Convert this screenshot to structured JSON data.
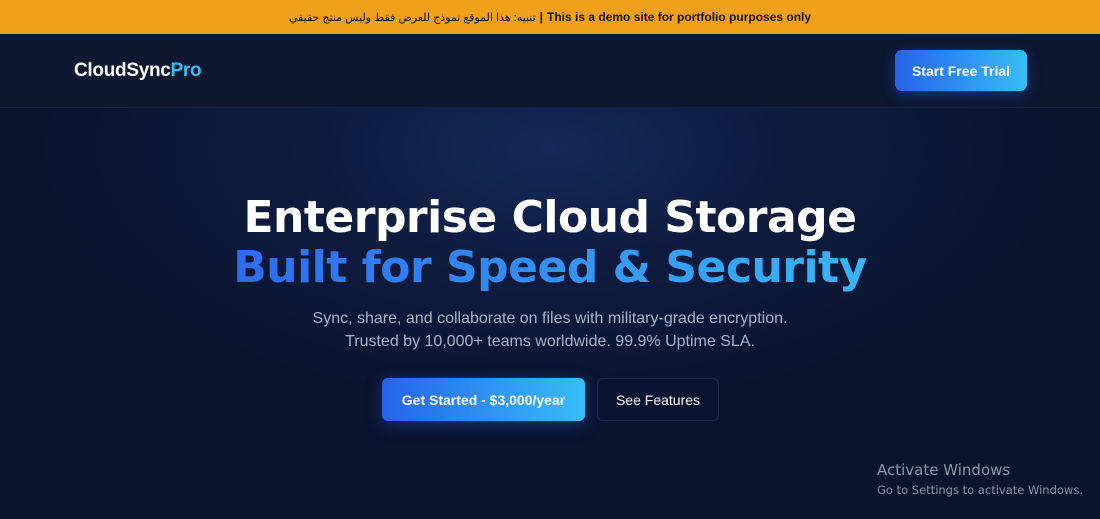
{
  "banner": {
    "arabic": "تنبيه: هذا الموقع نموذج للعرض فقط وليس منتج حقيقي",
    "separator": "|",
    "english": "This is a demo site for portfolio purposes only",
    "color": "#f0a01a"
  },
  "navbar": {
    "logo_main": "CloudSync",
    "logo_accent": "Pro",
    "cta_label": "Start Free Trial"
  },
  "hero": {
    "title_line1": "Enterprise Cloud Storage",
    "title_line2": "Built for Speed & Security",
    "subtitle_line1": "Sync, share, and collaborate on files with military-grade encryption.",
    "subtitle_line2": "Trusted by 10,000+ teams worldwide. 99.9% Uptime SLA.",
    "primary_button": "Get Started - $3,000/year",
    "secondary_button": "See Features"
  },
  "watermark": {
    "line1": "Activate Windows",
    "line2": "Go to Settings to activate Windows."
  },
  "colors": {
    "background": "#0c1630",
    "accent_start": "#2563eb",
    "accent_end": "#38bdf8"
  }
}
